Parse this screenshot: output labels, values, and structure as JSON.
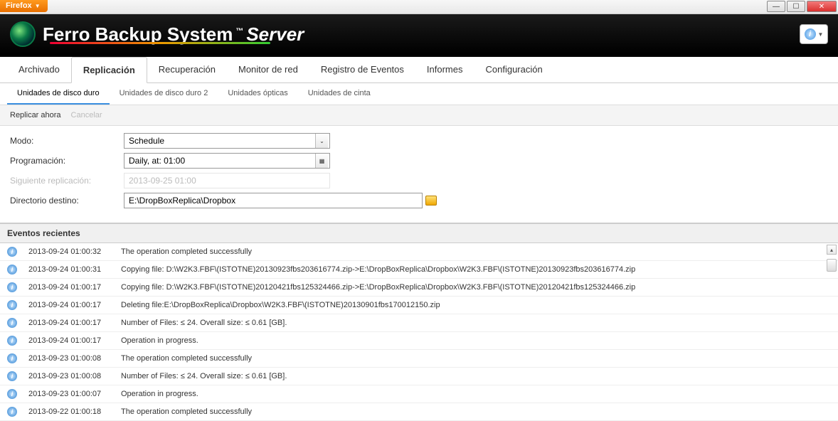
{
  "browser": {
    "label": "Firefox"
  },
  "app": {
    "title_main": "Ferro Backup System",
    "title_tm": "™",
    "title_srv": "Server"
  },
  "mainTabs": [
    {
      "label": "Archivado"
    },
    {
      "label": "Replicación"
    },
    {
      "label": "Recuperación"
    },
    {
      "label": "Monitor de red"
    },
    {
      "label": "Registro de Eventos"
    },
    {
      "label": "Informes"
    },
    {
      "label": "Configuración"
    }
  ],
  "subTabs": [
    {
      "label": "Unidades de disco duro"
    },
    {
      "label": "Unidades de disco duro 2"
    },
    {
      "label": "Unidades ópticas"
    },
    {
      "label": "Unidades de cinta"
    }
  ],
  "actions": {
    "replicate": "Replicar ahora",
    "cancel": "Cancelar"
  },
  "form": {
    "mode_label": "Modo:",
    "mode_value": "Schedule",
    "sched_label": "Programación:",
    "sched_value": "Daily, at: 01:00",
    "next_label": "Siguiente replicación:",
    "next_value": "2013-09-25 01:00",
    "dest_label": "Directorio destino:",
    "dest_value": "E:\\DropBoxReplica\\Dropbox"
  },
  "events": {
    "header": "Eventos recientes",
    "rows": [
      {
        "t": "2013-09-24 01:00:32",
        "m": "The operation completed successfully"
      },
      {
        "t": "2013-09-24 01:00:31",
        "m": "Copying file: D:\\W2K3.FBF\\(ISTOTNE)20130923fbs203616774.zip->E:\\DropBoxReplica\\Dropbox\\W2K3.FBF\\(ISTOTNE)20130923fbs203616774.zip"
      },
      {
        "t": "2013-09-24 01:00:17",
        "m": "Copying file: D:\\W2K3.FBF\\(ISTOTNE)20120421fbs125324466.zip->E:\\DropBoxReplica\\Dropbox\\W2K3.FBF\\(ISTOTNE)20120421fbs125324466.zip"
      },
      {
        "t": "2013-09-24 01:00:17",
        "m": "Deleting file:E:\\DropBoxReplica\\Dropbox\\W2K3.FBF\\(ISTOTNE)20130901fbs170012150.zip"
      },
      {
        "t": "2013-09-24 01:00:17",
        "m": "Number of Files: ≤ 24. Overall size: ≤ 0.61 [GB]."
      },
      {
        "t": "2013-09-24 01:00:17",
        "m": "Operation in progress."
      },
      {
        "t": "2013-09-23 01:00:08",
        "m": "The operation completed successfully"
      },
      {
        "t": "2013-09-23 01:00:08",
        "m": "Number of Files: ≤ 24. Overall size: ≤ 0.61 [GB]."
      },
      {
        "t": "2013-09-23 01:00:07",
        "m": "Operation in progress."
      },
      {
        "t": "2013-09-22 01:00:18",
        "m": "The operation completed successfully"
      }
    ]
  }
}
